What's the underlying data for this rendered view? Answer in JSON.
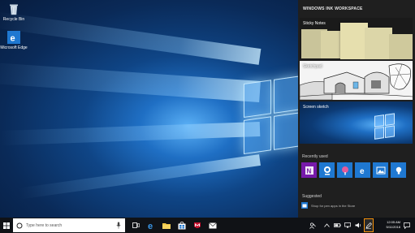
{
  "desktop": {
    "icons": [
      {
        "label": "Recycle Bin",
        "icon": "recycle-bin-icon"
      },
      {
        "label": "Microsoft Edge",
        "icon": "edge-icon"
      }
    ]
  },
  "ink_workspace": {
    "title": "WINDOWS INK WORKSPACE",
    "tiles": [
      {
        "label": "Sticky Notes"
      },
      {
        "label": "Sketchpad"
      },
      {
        "label": "Screen sketch"
      }
    ],
    "recently_used_label": "Recently used",
    "recent_apps": [
      {
        "icon": "onenote-icon",
        "color": "#7719aa"
      },
      {
        "icon": "webcam-icon",
        "color": "#1f78d1"
      },
      {
        "icon": "fresh-paint-icon",
        "color": "#1f78d1"
      },
      {
        "icon": "edge-icon",
        "color": "#1f78d1"
      },
      {
        "icon": "photos-icon",
        "color": "#1f78d1"
      },
      {
        "icon": "tips-icon",
        "color": "#1f78d1"
      }
    ],
    "suggested_label": "Suggested",
    "suggested_item": "Shop for pen apps in the Store"
  },
  "taskbar": {
    "search_placeholder": "Type here to search",
    "pinned": [
      "mic-icon",
      "task-view-icon",
      "edge-icon",
      "file-explorer-icon",
      "store-icon",
      "mcafee-icon",
      "mail-icon"
    ],
    "tray_icons": [
      "people-icon",
      "chevron-up-icon",
      "battery-icon",
      "network-icon",
      "volume-icon",
      "ink-workspace-icon"
    ],
    "time": "12:05 AM",
    "date": "5/11/2018",
    "accent": "#f7930c"
  }
}
